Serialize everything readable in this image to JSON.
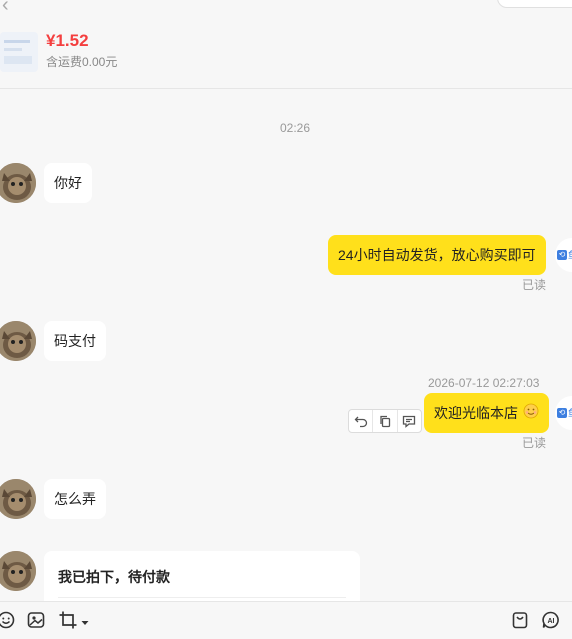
{
  "header": {
    "price": "¥1.52",
    "shipping": "含运费0.00元"
  },
  "chat": {
    "center_time": "02:26",
    "messages": [
      {
        "side": "left",
        "text": "你好"
      },
      {
        "side": "right",
        "text": "24小时自动发货，放心购买即可",
        "status": "已读"
      },
      {
        "side": "left",
        "text": "码支付"
      },
      {
        "side": "right",
        "text": "欢迎光临本店",
        "timestamp": "2026-07-12 02:27:03",
        "status": "已读"
      },
      {
        "side": "left",
        "text": "怎么弄"
      },
      {
        "side": "left",
        "type": "card",
        "text": "我已拍下，待付款"
      }
    ]
  },
  "seller_avatar_label": "鱼"
}
